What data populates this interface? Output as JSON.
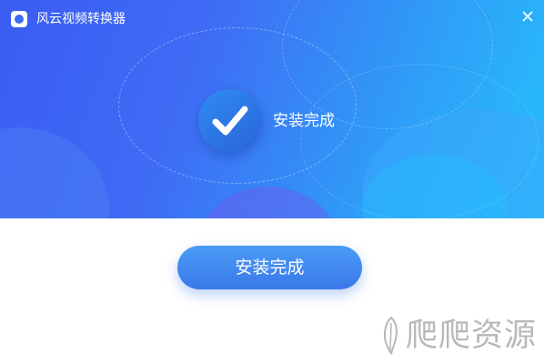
{
  "window": {
    "title": "风云视频转换器",
    "close_icon": "close-icon",
    "app_icon": "app-logo-icon"
  },
  "status": {
    "icon": "checkmark-icon",
    "text": "安装完成"
  },
  "actions": {
    "finish_label": "安装完成"
  },
  "watermark": {
    "text": "爬爬资源"
  },
  "colors": {
    "banner_start": "#3a5cf2",
    "banner_end": "#26c0fb",
    "button": "#3f86ef",
    "watermark": "#b8b8b8"
  }
}
